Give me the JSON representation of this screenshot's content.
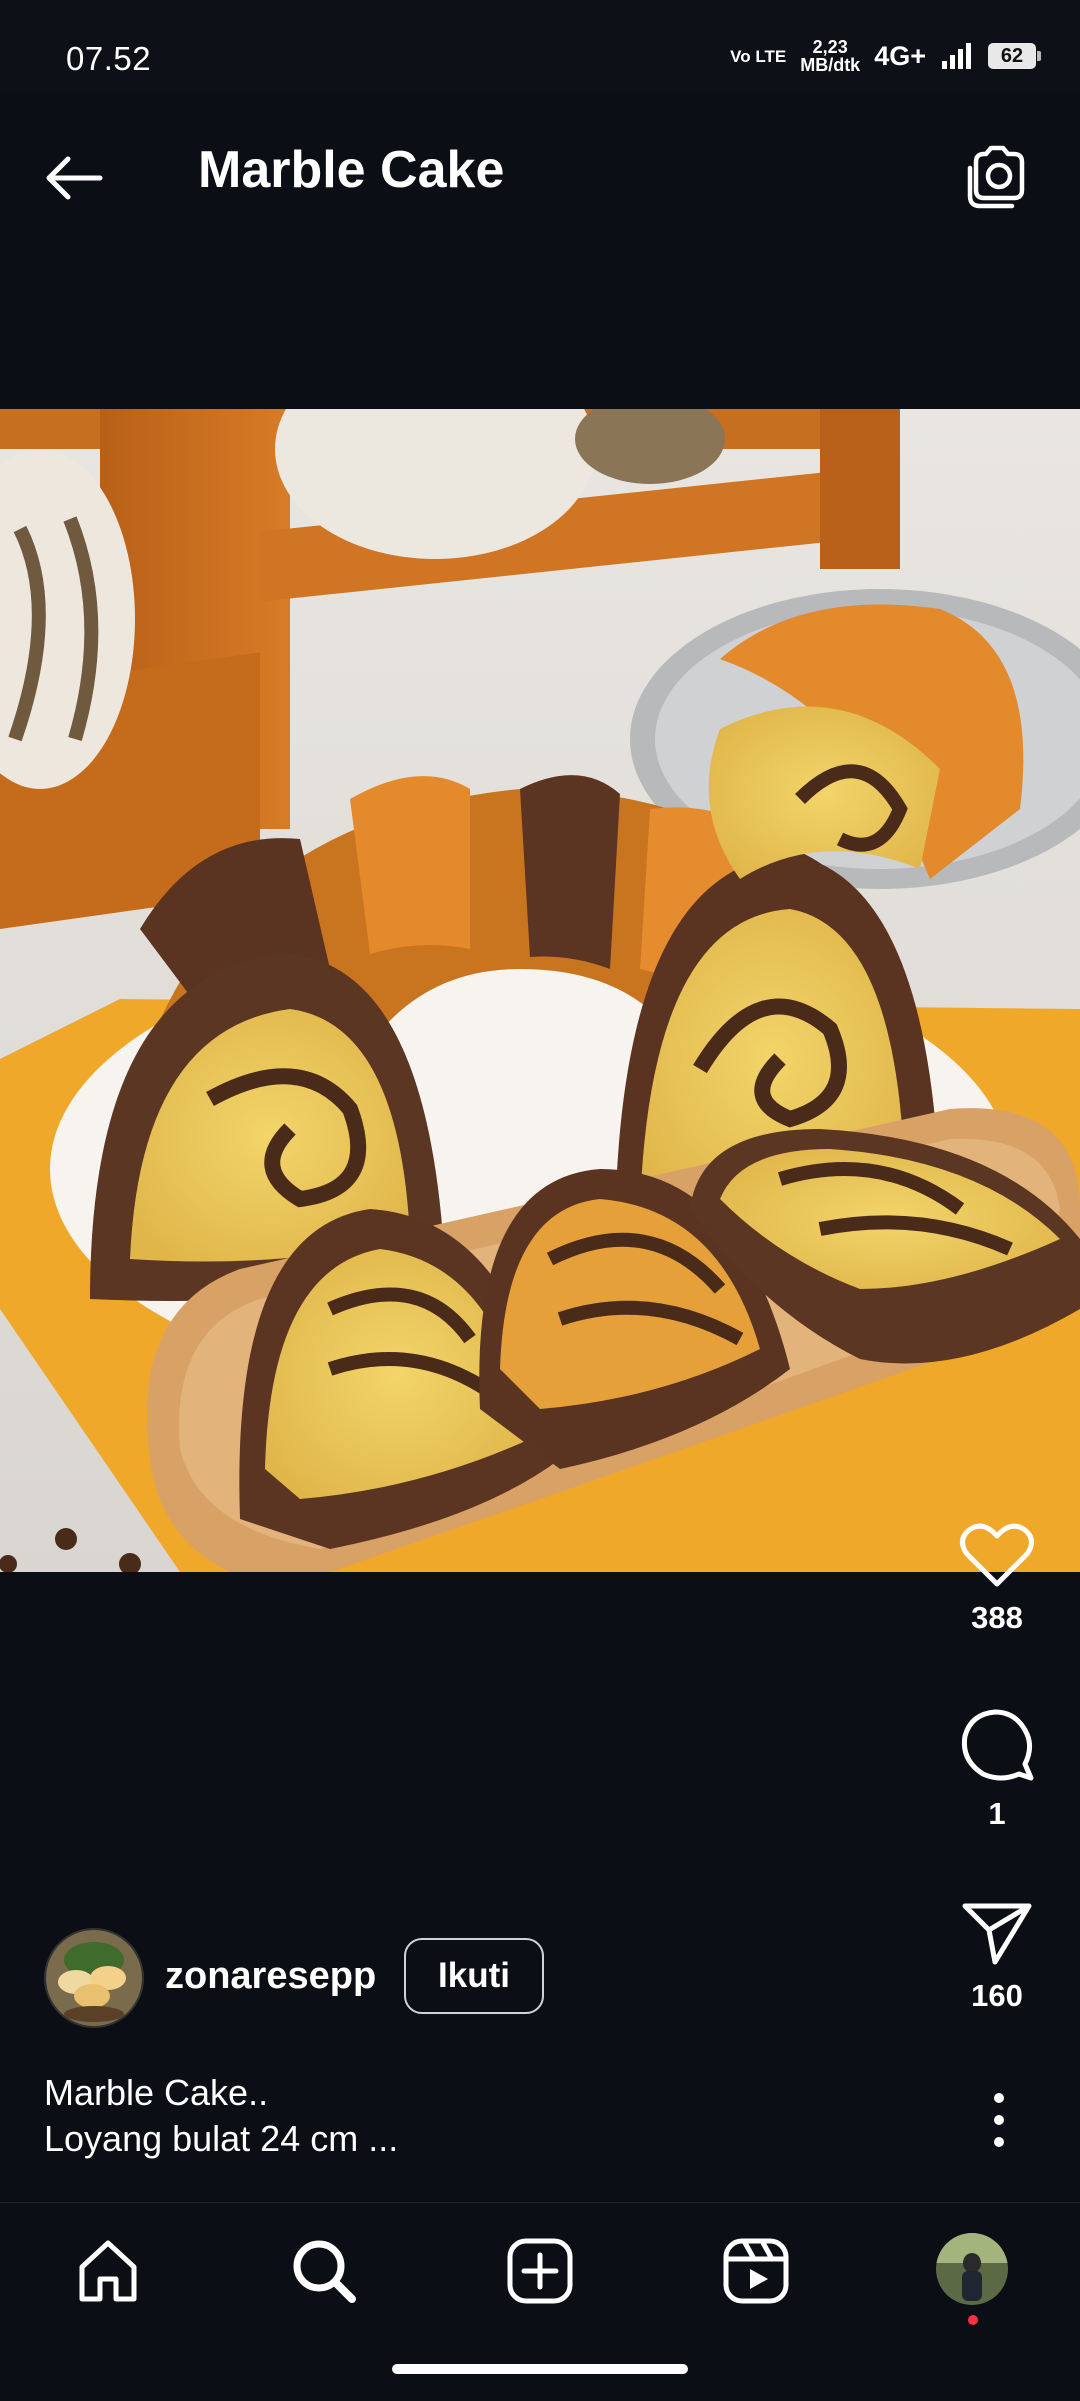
{
  "status_bar": {
    "time": "07.52",
    "volte": "Vo LTE",
    "net_speed_value": "2,23",
    "net_speed_unit": "MB/dtk",
    "network": "4G+",
    "battery": "62"
  },
  "header": {
    "title": "Marble Cake",
    "back_icon": "arrow-left-icon",
    "camera_icon": "camera-icon"
  },
  "post": {
    "image_alt": "marble bundt cake",
    "likes": "388",
    "comments": "1",
    "shares": "160",
    "author": "zonaresepp",
    "follow_label": "Ikuti",
    "caption_line1": "Marble Cake..",
    "caption_line2": "Loyang bulat 24 cm ..."
  },
  "bottom_nav": {
    "items": [
      "home-icon",
      "search-icon",
      "create-icon",
      "reels-icon",
      "profile-avatar"
    ]
  },
  "colors": {
    "background": "#0b0e14",
    "status_bar": "#0d1117",
    "notification": "#ff3040"
  }
}
